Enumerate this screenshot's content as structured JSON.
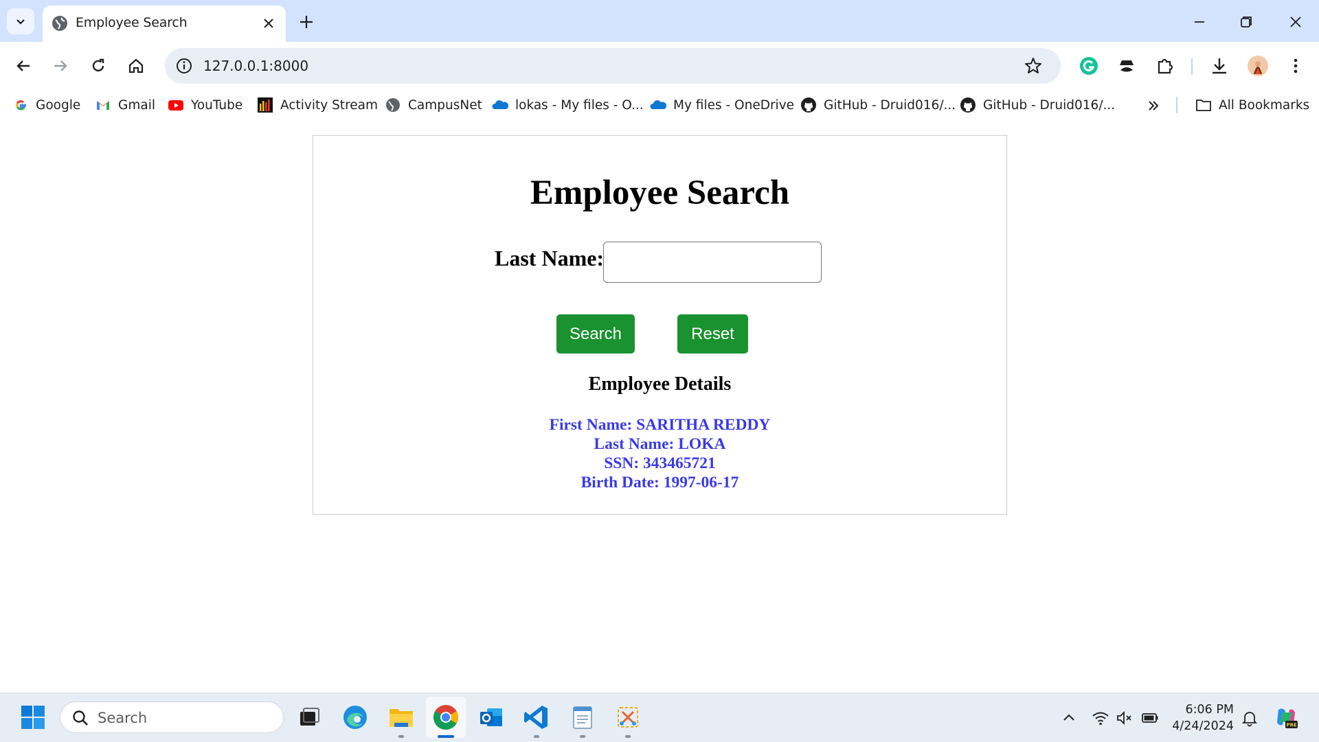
{
  "browser": {
    "tab": {
      "title": "Employee Search"
    },
    "url": "127.0.0.1:8000",
    "bookmarks": [
      {
        "label": "Google",
        "icon": "google-icon"
      },
      {
        "label": "Gmail",
        "icon": "gmail-icon"
      },
      {
        "label": "YouTube",
        "icon": "youtube-icon"
      },
      {
        "label": "Activity Stream",
        "icon": "activity-stream-icon"
      },
      {
        "label": "CampusNet",
        "icon": "globe-icon"
      },
      {
        "label": "lokas - My files - O...",
        "icon": "onedrive-icon"
      },
      {
        "label": "My files - OneDrive",
        "icon": "onedrive-icon"
      },
      {
        "label": "GitHub - Druid016/...",
        "icon": "github-icon"
      },
      {
        "label": "GitHub - Druid016/...",
        "icon": "github-icon"
      }
    ],
    "all_bookmarks_label": "All Bookmarks"
  },
  "page": {
    "title": "Employee Search",
    "form": {
      "last_name_label": "Last Name:",
      "last_name_value": "",
      "search_label": "Search",
      "reset_label": "Reset"
    },
    "details": {
      "heading": "Employee Details",
      "first_name": "First Name: SARITHA REDDY",
      "last_name": "Last Name: LOKA",
      "ssn": "SSN: 343465721",
      "birth_date": "Birth Date: 1997-06-17"
    }
  },
  "taskbar": {
    "search_label": "Search",
    "time": "6:06 PM",
    "date": "4/24/2024"
  },
  "colors": {
    "tabstrip": "#d3e3fd",
    "button_green": "#1a922f",
    "details_blue": "#3a3ae6"
  }
}
